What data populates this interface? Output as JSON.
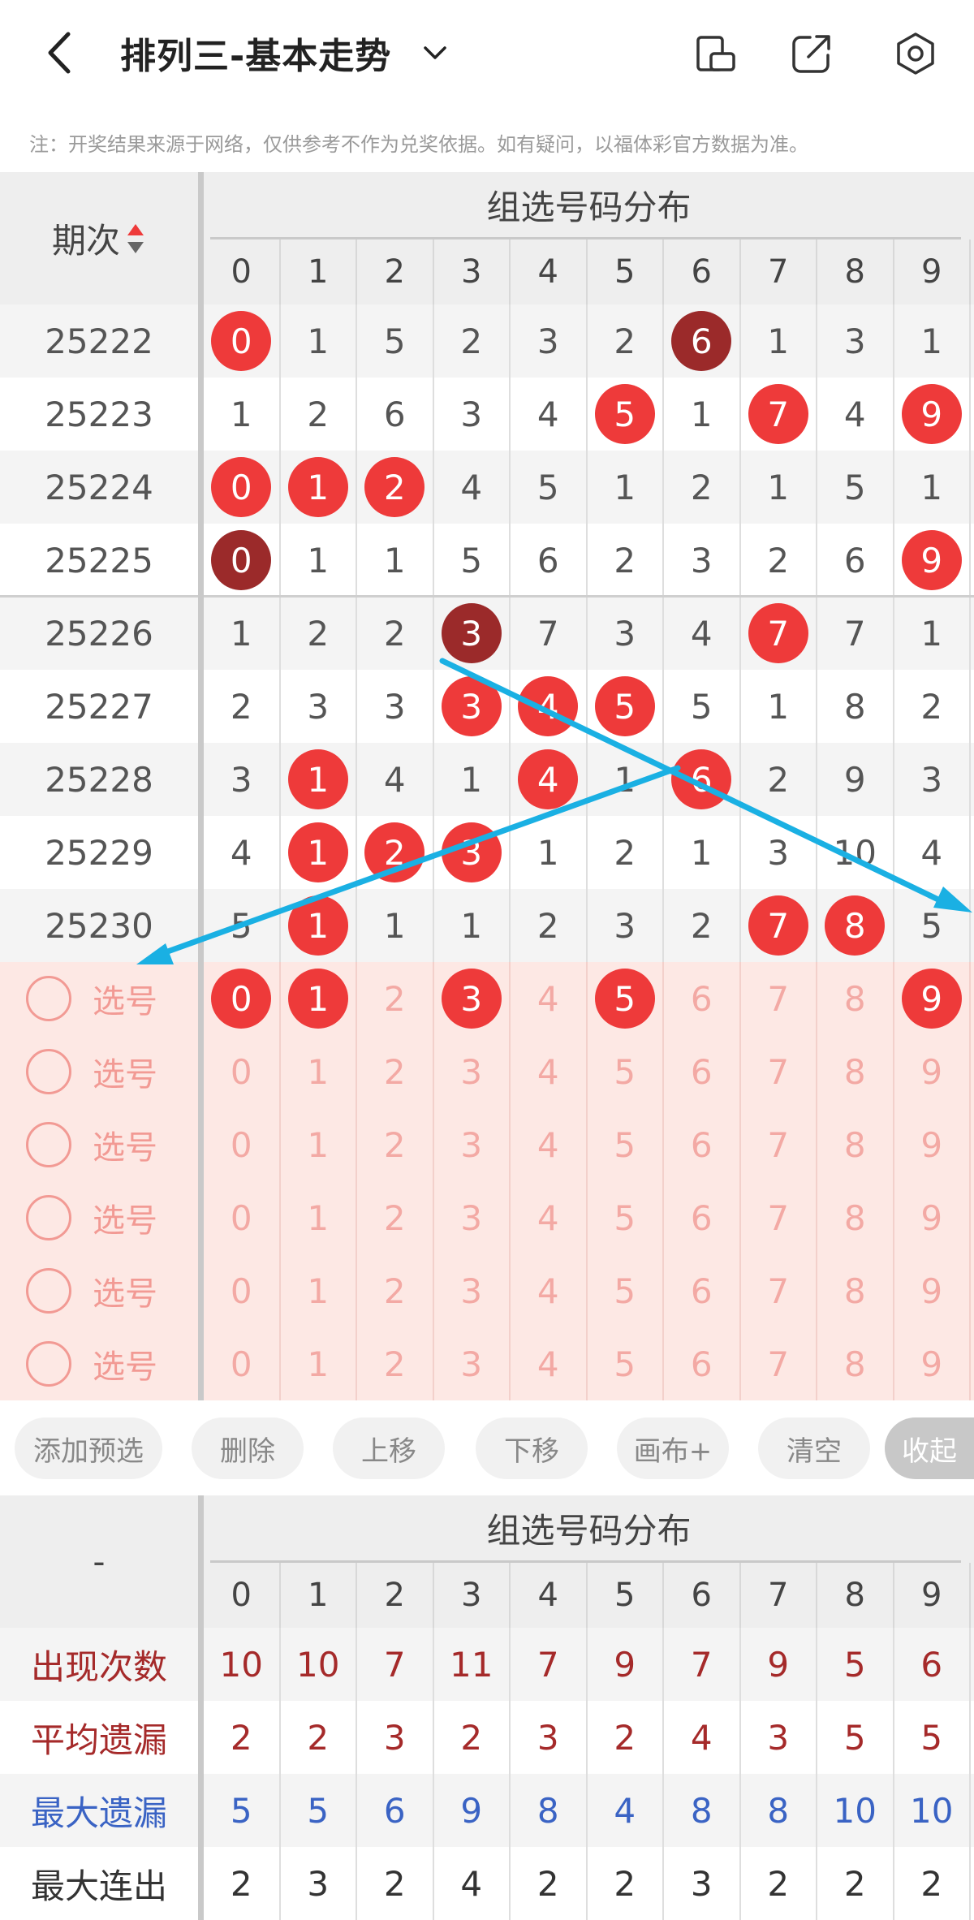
{
  "header": {
    "title": "排列三-基本走势",
    "back_icon": "chevron-left-icon",
    "dropdown_icon": "chevron-down-icon",
    "icons": [
      "phone-landscape-icon",
      "share-icon",
      "gear-icon"
    ]
  },
  "notice": "注：开奖结果来源于网络，仅供参考不作为兑奖依据。如有疑问，以福体彩官方数据为准。",
  "grid": {
    "period_header": "期次",
    "dist_header": "组选号码分布",
    "digits": [
      "0",
      "1",
      "2",
      "3",
      "4",
      "5",
      "6",
      "7",
      "8",
      "9"
    ],
    "rows": [
      {
        "period": "25222",
        "cells": [
          "0",
          "1",
          "5",
          "2",
          "3",
          "2",
          "6",
          "1",
          "3",
          "1"
        ],
        "balls": {
          "0": "red",
          "6": "dark"
        }
      },
      {
        "period": "25223",
        "cells": [
          "1",
          "2",
          "6",
          "3",
          "4",
          "5",
          "1",
          "7",
          "4",
          "9"
        ],
        "balls": {
          "5": "red",
          "7": "red",
          "9": "red"
        }
      },
      {
        "period": "25224",
        "cells": [
          "0",
          "1",
          "2",
          "4",
          "5",
          "1",
          "2",
          "1",
          "5",
          "1"
        ],
        "balls": {
          "0": "red",
          "1": "red",
          "2": "red"
        }
      },
      {
        "period": "25225",
        "cells": [
          "0",
          "1",
          "1",
          "5",
          "6",
          "2",
          "3",
          "2",
          "6",
          "9"
        ],
        "balls": {
          "0": "dark",
          "9": "red"
        }
      },
      {
        "period": "25226",
        "cells": [
          "1",
          "2",
          "2",
          "3",
          "7",
          "3",
          "4",
          "7",
          "7",
          "1"
        ],
        "balls": {
          "3": "dark",
          "7": "red"
        }
      },
      {
        "period": "25227",
        "cells": [
          "2",
          "3",
          "3",
          "3",
          "4",
          "5",
          "5",
          "1",
          "8",
          "2"
        ],
        "balls": {
          "3": "red",
          "4": "red",
          "5": "red"
        }
      },
      {
        "period": "25228",
        "cells": [
          "3",
          "1",
          "4",
          "1",
          "4",
          "1",
          "6",
          "2",
          "9",
          "3"
        ],
        "balls": {
          "1": "red",
          "4": "red",
          "6": "red"
        }
      },
      {
        "period": "25229",
        "cells": [
          "4",
          "1",
          "2",
          "3",
          "1",
          "2",
          "1",
          "3",
          "10",
          "4"
        ],
        "balls": {
          "1": "red",
          "2": "red",
          "3": "red"
        }
      },
      {
        "period": "25230",
        "cells": [
          "5",
          "1",
          "1",
          "1",
          "2",
          "3",
          "2",
          "7",
          "8",
          "5"
        ],
        "balls": {
          "1": "red",
          "7": "red",
          "8": "red"
        }
      }
    ],
    "pick_label": "选号",
    "pick_rows": [
      {
        "balls": [
          "0",
          "1",
          "3",
          "5",
          "9"
        ]
      },
      {
        "balls": []
      },
      {
        "balls": []
      },
      {
        "balls": []
      },
      {
        "balls": []
      },
      {
        "balls": []
      }
    ]
  },
  "toolbar": {
    "add": "添加预选",
    "delete": "删除",
    "up": "上移",
    "down": "下移",
    "canvas": "画布+",
    "clear": "清空",
    "collapse": "收起"
  },
  "stats": {
    "corner": "-",
    "dist_header": "组选号码分布",
    "digits": [
      "0",
      "1",
      "2",
      "3",
      "4",
      "5",
      "6",
      "7",
      "8",
      "9"
    ],
    "rows": [
      {
        "label": "出现次数",
        "values": [
          "10",
          "10",
          "7",
          "11",
          "7",
          "9",
          "7",
          "9",
          "5",
          "6"
        ],
        "color": "#a52a2a"
      },
      {
        "label": "平均遗漏",
        "values": [
          "2",
          "2",
          "3",
          "2",
          "3",
          "2",
          "4",
          "3",
          "5",
          "5"
        ],
        "color": "#a52a2a"
      },
      {
        "label": "最大遗漏",
        "values": [
          "5",
          "5",
          "6",
          "9",
          "8",
          "4",
          "8",
          "8",
          "10",
          "10"
        ],
        "color": "#3a63c4"
      },
      {
        "label": "最大连出",
        "values": [
          "2",
          "3",
          "2",
          "4",
          "2",
          "2",
          "3",
          "2",
          "2",
          "2"
        ],
        "color": "#333333"
      }
    ]
  },
  "colors": {
    "ball_red": "#ee3a3a",
    "ball_dark": "#9b2a2a",
    "pick_bg": "#fde8e4",
    "arrow": "#1ab0e3"
  }
}
